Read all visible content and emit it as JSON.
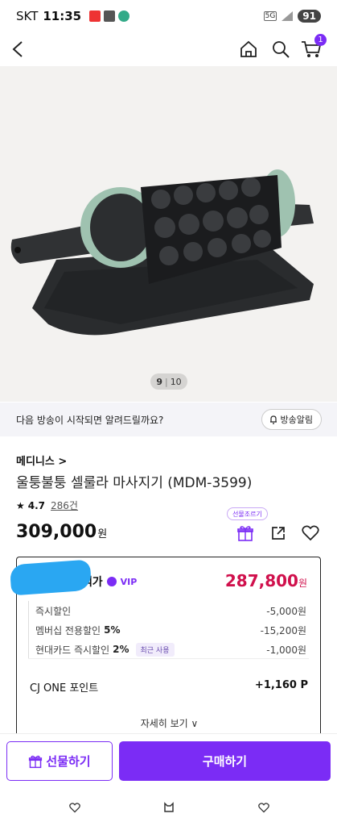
{
  "status_bar": {
    "carrier": "SKT",
    "time": "11:35",
    "network": "5G",
    "battery": "91"
  },
  "header": {
    "cart_count": "1"
  },
  "gallery": {
    "current": "9",
    "total": "10"
  },
  "broadcast_alert": {
    "text": "다음 방송이 시작되면 알려드릴까요?",
    "button_label": "방송알림"
  },
  "product": {
    "brand": "메디니스 >",
    "title": "울퉁불퉁 셀룰라 마사지기 (MDM-3599)",
    "rating": "4.7",
    "review_count": "286건",
    "price": "309,000",
    "price_unit": "원",
    "gift_tooltip": "선물조르기"
  },
  "benefit": {
    "title": "혜택가",
    "vip_label": "VIP",
    "price": "287,800",
    "price_unit": "원",
    "lines": [
      {
        "label": "즉시할인",
        "percent": "",
        "tag": "",
        "value": "-5,000원"
      },
      {
        "label": "멤버십 전용할인",
        "percent": "5%",
        "tag": "",
        "value": "-15,200원"
      },
      {
        "label": "현대카드 즉시할인",
        "percent": "2%",
        "tag": "최근 사용",
        "value": "-1,000원"
      }
    ],
    "points_label": "CJ ONE 포인트",
    "points_value": "+1,160 P",
    "detail_link": "자세히 보기 ∨"
  },
  "actions": {
    "gift_label": "선물하기",
    "buy_label": "구매하기"
  },
  "colors": {
    "accent": "#7b2cf5",
    "benefit_price": "#d0104c"
  }
}
